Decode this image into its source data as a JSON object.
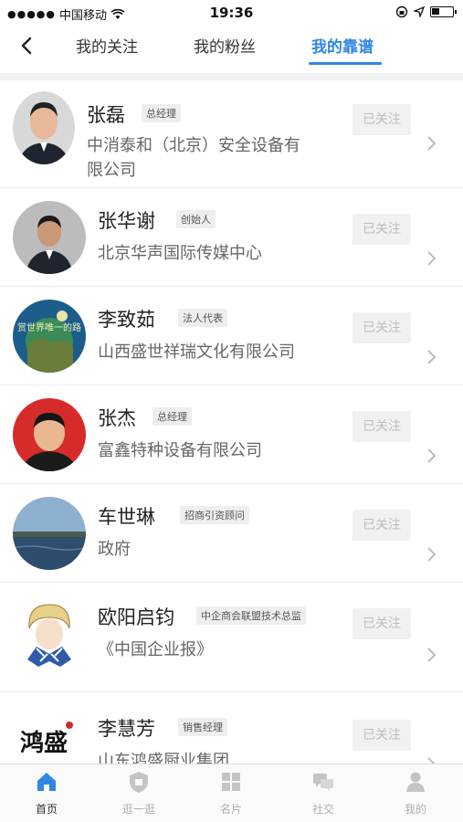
{
  "status_bar": {
    "carrier": "中国移动",
    "time": "19:36"
  },
  "nav": {
    "tabs": [
      {
        "label": "我的关注",
        "active": false
      },
      {
        "label": "我的粉丝",
        "active": false
      },
      {
        "label": "我的靠谱",
        "active": true
      }
    ]
  },
  "contacts": [
    {
      "name": "张磊",
      "title": "总经理",
      "company": "中消泰和（北京）安全设备有\n限公司",
      "follow_label": "已关注"
    },
    {
      "name": "张华谢",
      "title": "创始人",
      "company": "北京华声国际传媒中心",
      "follow_label": "已关注"
    },
    {
      "name": "李致茹",
      "title": "法人代表",
      "company": "山西盛世祥瑞文化有限公司",
      "follow_label": "已关注"
    },
    {
      "name": "张杰",
      "title": "总经理",
      "company": "富鑫特种设备有限公司",
      "follow_label": "已关注"
    },
    {
      "name": "车世琳",
      "title": "招商引资顾问",
      "company": "政府",
      "follow_label": "已关注"
    },
    {
      "name": "欧阳启钧",
      "title": "中企商会联盟技术总监",
      "company": "《中国企业报》",
      "follow_label": "已关注"
    },
    {
      "name": "李慧芳",
      "title": "销售经理",
      "company": "山东鸿盛厨业集团",
      "follow_label": "已关注"
    }
  ],
  "avatar_text": {
    "li_zhiru": "赏世界唯一的路",
    "li_huifang": "鸿盛"
  },
  "tabbar": {
    "items": [
      {
        "label": "首页",
        "icon": "home-icon",
        "active": true
      },
      {
        "label": "逛一逛",
        "icon": "shield-icon",
        "active": false
      },
      {
        "label": "名片",
        "icon": "grid-icon",
        "active": false
      },
      {
        "label": "社交",
        "icon": "chat-icon",
        "active": false
      },
      {
        "label": "我的",
        "icon": "person-icon",
        "active": false
      }
    ]
  },
  "colors": {
    "accent": "#2f86e4",
    "follow_bg": "#f1f1f1",
    "follow_text": "#bdbdbd"
  }
}
